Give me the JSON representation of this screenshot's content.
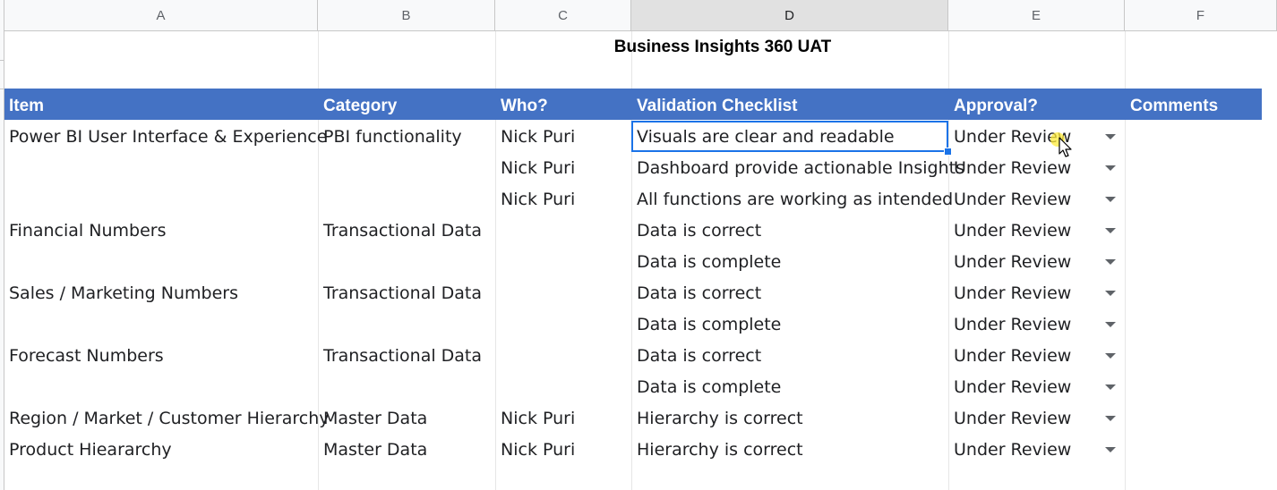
{
  "columns": [
    "A",
    "B",
    "C",
    "D",
    "E",
    "F"
  ],
  "title": "Business Insights 360 UAT",
  "headers": {
    "item": "Item",
    "category": "Category",
    "who": "Who?",
    "validation": "Validation Checklist",
    "approval": "Approval?",
    "comments": "Comments"
  },
  "rows": [
    {
      "item": "Power BI User Interface & Experience",
      "category": "PBI functionality",
      "who": "Nick Puri",
      "validation": "Visuals are clear and readable",
      "approval": "Under Review",
      "comments": ""
    },
    {
      "item": "",
      "category": "",
      "who": "Nick Puri",
      "validation": "Dashboard provide actionable Insights",
      "approval": "Under Review",
      "comments": ""
    },
    {
      "item": "",
      "category": "",
      "who": "Nick Puri",
      "validation": "All functions are working as intended",
      "approval": "Under Review",
      "comments": ""
    },
    {
      "item": "Financial Numbers",
      "category": "Transactional Data",
      "who": "",
      "validation": "Data is correct",
      "approval": "Under Review",
      "comments": ""
    },
    {
      "item": "",
      "category": "",
      "who": "",
      "validation": "Data is complete",
      "approval": "Under Review",
      "comments": ""
    },
    {
      "item": "Sales / Marketing Numbers",
      "category": "Transactional Data",
      "who": "",
      "validation": "Data is correct",
      "approval": "Under Review",
      "comments": ""
    },
    {
      "item": "",
      "category": "",
      "who": "",
      "validation": "Data is complete",
      "approval": "Under Review",
      "comments": ""
    },
    {
      "item": "Forecast Numbers",
      "category": "Transactional Data",
      "who": "",
      "validation": "Data is correct",
      "approval": "Under Review",
      "comments": ""
    },
    {
      "item": "",
      "category": "",
      "who": "",
      "validation": "Data is complete",
      "approval": "Under Review",
      "comments": ""
    },
    {
      "item": "Region / Market / Customer Hierarchy",
      "category": "Master Data",
      "who": "Nick Puri",
      "validation": "Hierarchy is correct",
      "approval": "Under Review",
      "comments": ""
    },
    {
      "item": "Product Hieararchy",
      "category": "Master Data",
      "who": "Nick Puri",
      "validation": "Hierarchy is correct",
      "approval": "Under Review",
      "comments": ""
    }
  ],
  "selected_cell": "D",
  "colors": {
    "header_band": "#4472c4",
    "selection": "#1a73e8",
    "cursor_highlight": "#ffeb3b"
  },
  "icons": {
    "dropdown": "dropdown-arrow-icon",
    "cursor": "mouse-pointer-icon"
  }
}
